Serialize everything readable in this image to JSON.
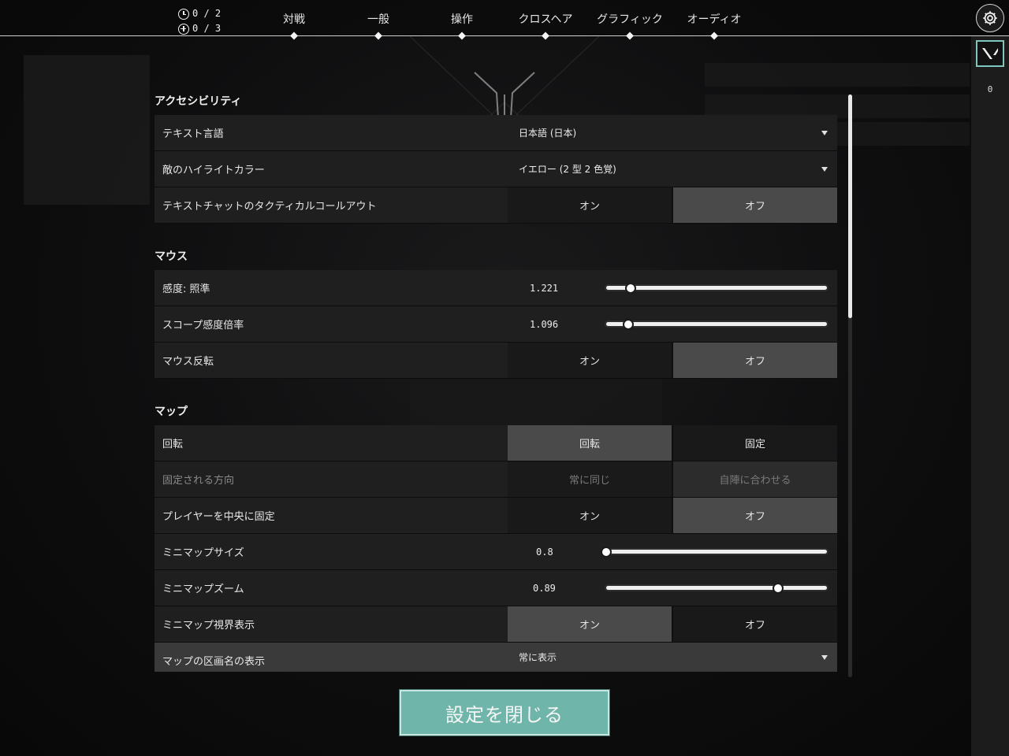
{
  "hud": {
    "counter1": "0 / 2",
    "counter2": "0 / 3",
    "side_count": "0"
  },
  "tabs": [
    {
      "label": "対戦"
    },
    {
      "label": "一般"
    },
    {
      "label": "操作"
    },
    {
      "label": "クロスヘア"
    },
    {
      "label": "グラフィック"
    },
    {
      "label": "オーディオ"
    }
  ],
  "sections": {
    "accessibility": {
      "title": "アクセシビリティ",
      "text_language": {
        "label": "テキスト言語",
        "value": "日本語 (日本)"
      },
      "enemy_highlight": {
        "label": "敵のハイライトカラー",
        "value": "イエロー (2 型 2 色覚)"
      },
      "tactical_callout": {
        "label": "テキストチャットのタクティカルコールアウト",
        "on": "オン",
        "off": "オフ",
        "selected": "off"
      }
    },
    "mouse": {
      "title": "マウス",
      "sensitivity": {
        "label": "感度: 照準",
        "value": "1.221",
        "fraction": 0.11
      },
      "scope_sensitivity": {
        "label": "スコープ感度倍率",
        "value": "1.096",
        "fraction": 0.1
      },
      "invert": {
        "label": "マウス反転",
        "on": "オン",
        "off": "オフ",
        "selected": "off"
      }
    },
    "map": {
      "title": "マップ",
      "rotation": {
        "label": "回転",
        "rotate": "回転",
        "fixed": "固定",
        "selected": "rotate"
      },
      "fixed_orientation": {
        "label": "固定される方向",
        "always": "常に同じ",
        "team": "自陣に合わせる",
        "selected": "team"
      },
      "center_player": {
        "label": "プレイヤーを中央に固定",
        "on": "オン",
        "off": "オフ",
        "selected": "off"
      },
      "minimap_size": {
        "label": "ミニマップサイズ",
        "value": "0.8",
        "fraction": 0.0
      },
      "minimap_zoom": {
        "label": "ミニマップズーム",
        "value": "0.89",
        "fraction": 0.78
      },
      "minimap_vision": {
        "label": "ミニマップ視界表示",
        "on": "オン",
        "off": "オフ",
        "selected": "on"
      },
      "region_names": {
        "label": "マップの区画名の表示",
        "value": "常に表示"
      }
    }
  },
  "close_button": "設定を閉じる",
  "colors": {
    "accent": "#6fb5aa",
    "accent_border": "#7fc7bc"
  },
  "icons": {
    "settings": "gear-icon",
    "logo": "valorant-logo-icon"
  }
}
